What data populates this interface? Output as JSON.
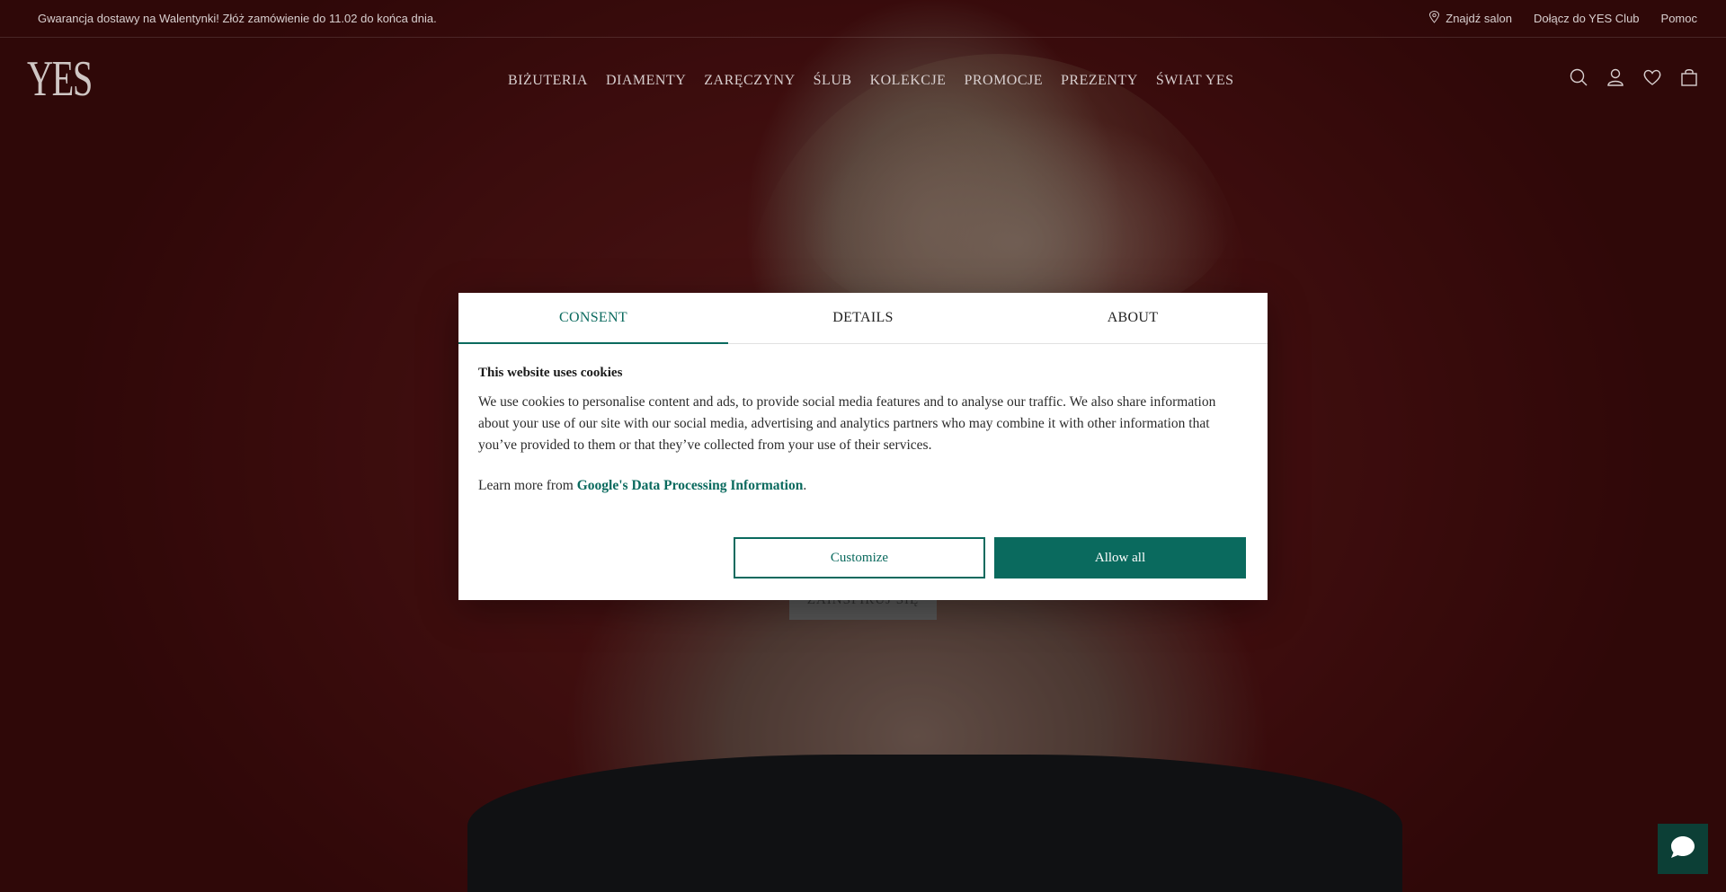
{
  "announcement": {
    "text": "Gwarancja dostawy na Walentynki! Złóż zamówienie do 11.02 do końca dnia.",
    "links": {
      "find_salon": "Znajdź salon",
      "join_club": "Dołącz do YES Club",
      "help": "Pomoc"
    }
  },
  "header": {
    "logo": "YES",
    "nav": [
      "BIŻUTERIA",
      "DIAMENTY",
      "ZARĘCZYNY",
      "ŚLUB",
      "KOLEKCJE",
      "PROMOCJE",
      "PREZENTY",
      "ŚWIAT YES"
    ],
    "icons": [
      "search-icon",
      "account-icon",
      "wishlist-icon",
      "bag-icon"
    ]
  },
  "hero": {
    "cta_label": "ZAINSPIRUJ SIĘ"
  },
  "cookie_modal": {
    "tabs": [
      "CONSENT",
      "DETAILS",
      "ABOUT"
    ],
    "active_tab": "CONSENT",
    "title": "This website uses cookies",
    "body": "We use cookies to personalise content and ads, to provide social media features and to analyse our traffic. We also share information about your use of our site with our social media, advertising and analytics partners who may combine it with other information that you’ve provided to them or that they’ve collected from your use of their services.",
    "learn_more_prefix": "Learn more from ",
    "learn_more_link": "Google's Data Processing Information",
    "learn_more_suffix": ".",
    "customize_label": "Customize",
    "allow_all_label": "Allow all"
  },
  "colors": {
    "accent": "#0a6a5e",
    "hero_bg": "#641617"
  },
  "chat": {
    "icon": "chat-bubble-icon"
  }
}
